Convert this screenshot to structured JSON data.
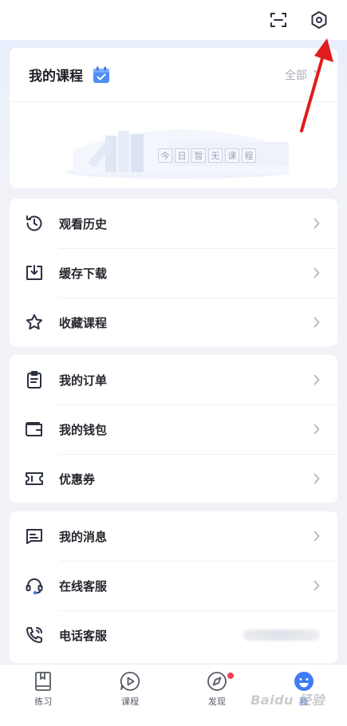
{
  "colors": {
    "accent": "#3d7cf5",
    "icon_stroke": "#2c3140",
    "chevron": "#b4b8c0",
    "badge_red": "#f0424f",
    "annotation_red": "#e11c1c"
  },
  "header": {
    "scan_icon": "scan-icon",
    "settings_icon": "settings-hexagon-icon"
  },
  "my_courses": {
    "title": "我的课程",
    "view_all": "全部",
    "empty_text": [
      "今",
      "日",
      "暂",
      "无",
      "课",
      "程"
    ]
  },
  "menu_group_1": [
    {
      "label": "观看历史",
      "icon": "history-clock-icon"
    },
    {
      "label": "缓存下载",
      "icon": "download-cache-icon"
    },
    {
      "label": "收藏课程",
      "icon": "star-favorite-icon"
    }
  ],
  "menu_group_2": [
    {
      "label": "我的订单",
      "icon": "clipboard-order-icon"
    },
    {
      "label": "我的钱包",
      "icon": "wallet-icon"
    },
    {
      "label": "优惠券",
      "icon": "coupon-ticket-icon"
    }
  ],
  "menu_group_3": [
    {
      "label": "我的消息",
      "icon": "message-icon"
    },
    {
      "label": "在线客服",
      "icon": "headset-icon"
    },
    {
      "label": "电话客服",
      "icon": "phone-icon"
    }
  ],
  "tabbar": [
    {
      "label": "练习",
      "icon": "book-practice-icon"
    },
    {
      "label": "课程",
      "icon": "play-course-icon"
    },
    {
      "label": "发现",
      "icon": "compass-discover-icon"
    },
    {
      "label": "我",
      "icon": "smiley-me-icon"
    }
  ],
  "watermark": "Baidu 经验"
}
